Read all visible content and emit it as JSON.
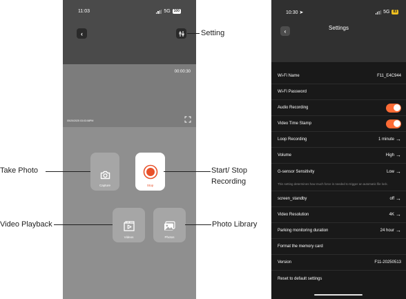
{
  "left_screen": {
    "status_time": "11:03",
    "network": "5G",
    "battery": "100",
    "timer": "00:00:30",
    "video_date": "05/20/2025 03:03:08PM",
    "capture_label": "Capture",
    "stop_label": "Stop",
    "videos_label": "Videos",
    "photos_label": "Photos"
  },
  "callouts": {
    "setting": "Setting",
    "take_photo": "Take Photo",
    "start_stop_1": "Start/ Stop",
    "start_stop_2": "Recording",
    "video_playback": "Video Playback",
    "photo_library": "Photo Library"
  },
  "right_screen": {
    "status_time": "10:30",
    "network": "5G",
    "battery": "83",
    "title": "Settings",
    "rows": [
      {
        "label": "Wi-Fi Name",
        "value": "F11_E4C944"
      },
      {
        "label": "Wi-Fi Password",
        "value": ""
      },
      {
        "label": "Audio Recording",
        "toggle": "on"
      },
      {
        "label": "Video Time Stamp",
        "toggle": "on"
      },
      {
        "label": "Loop Recording",
        "value": "1 minute"
      },
      {
        "label": "Volume",
        "value": "High"
      },
      {
        "label": "G-sensor Sensitivity",
        "value": "Low"
      },
      {
        "label": "screen_standby",
        "value": "off"
      },
      {
        "label": "Video Resolution",
        "value": "4K"
      },
      {
        "label": "Parking monitoring duration",
        "value": "24 hour"
      },
      {
        "label": "Format the memory card",
        "value": ""
      },
      {
        "label": "Version",
        "value": "F11-20250513"
      },
      {
        "label": "Reset to default settings",
        "value": ""
      }
    ],
    "gsensor_note": "This setting determines how much force is needed to trigger an automatic file lock.",
    "arrow_glyph": "→"
  },
  "colors": {
    "accent_orange": "#fe6b35",
    "record_red": "#e8512a",
    "dark_bg": "#191919",
    "gray_panel": "#8f8f8f"
  },
  "icons": [
    "back-chevron-icon",
    "settings-sliders-icon",
    "fullscreen-icon",
    "camera-icon",
    "record-icon",
    "video-playback-icon",
    "photo-gallery-icon",
    "signal-icon",
    "battery-icon",
    "location-arrow-icon"
  ]
}
